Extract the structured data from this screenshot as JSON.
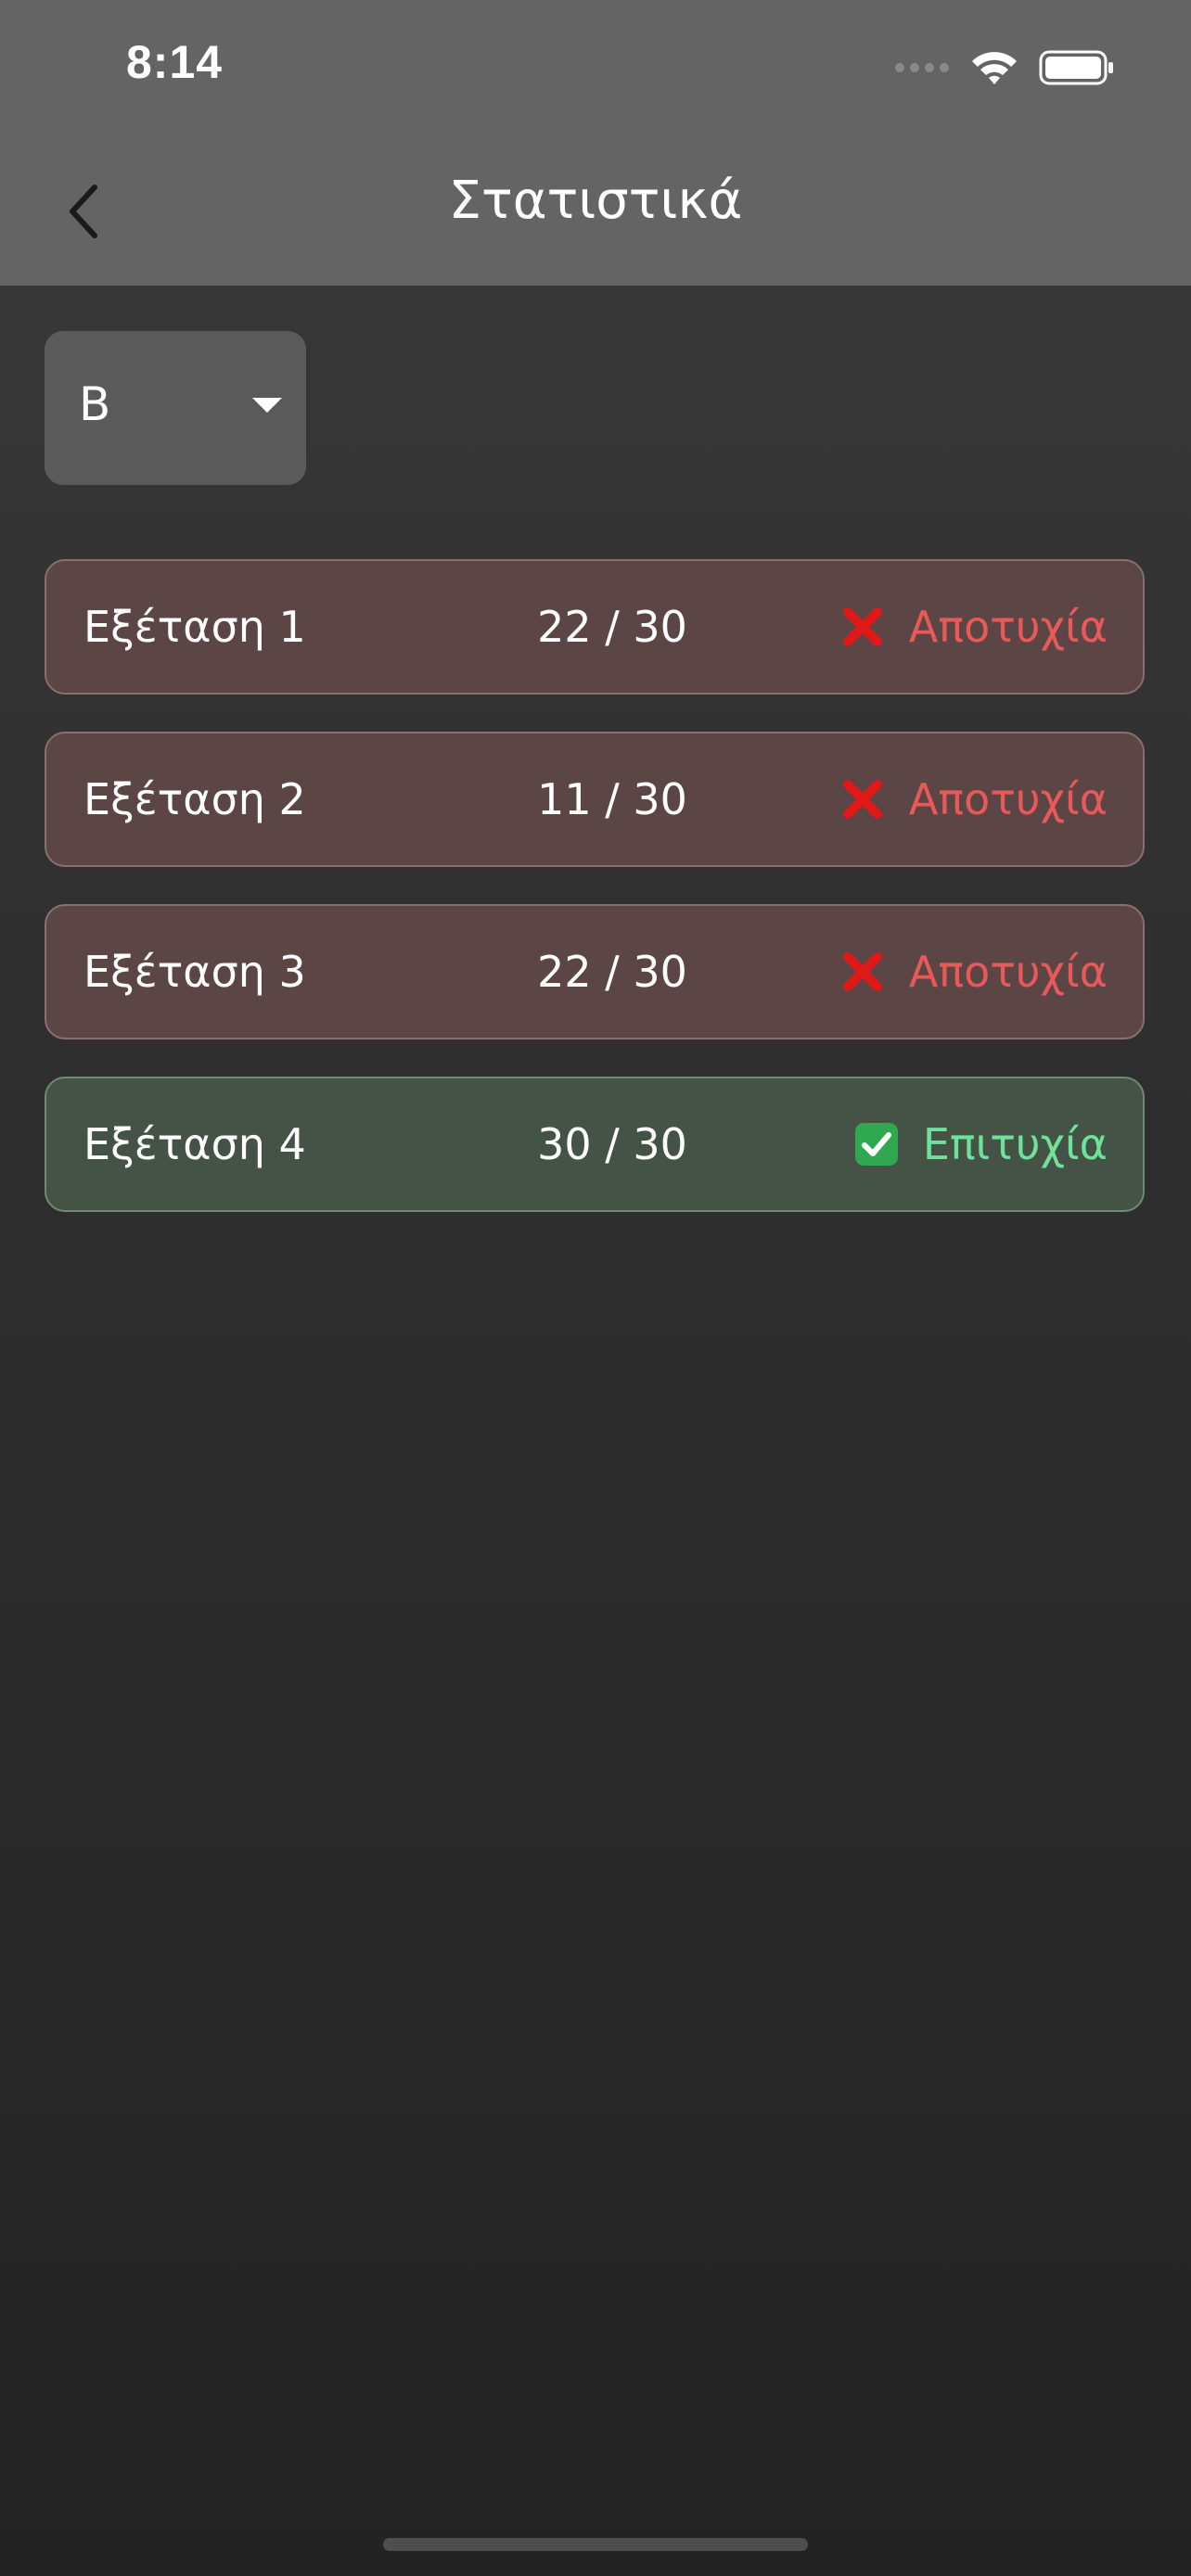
{
  "status_bar": {
    "time": "8:14",
    "icons": [
      "cellular-signal-icon",
      "wifi-icon",
      "battery-icon"
    ]
  },
  "nav": {
    "back_icon": "chevron-left-icon",
    "title": "Στατιστικά"
  },
  "dropdown": {
    "selected": "B",
    "icon": "caret-down-icon"
  },
  "exams": [
    {
      "name": "Εξέταση 1",
      "score": "22 / 30",
      "status": "Αποτυχία",
      "result": "fail",
      "icon": "cross-mark-icon"
    },
    {
      "name": "Εξέταση 2",
      "score": "11 / 30",
      "status": "Αποτυχία",
      "result": "fail",
      "icon": "cross-mark-icon"
    },
    {
      "name": "Εξέταση 3",
      "score": "22 / 30",
      "status": "Αποτυχία",
      "result": "fail",
      "icon": "cross-mark-icon"
    },
    {
      "name": "Εξέταση 4",
      "score": "30 / 30",
      "status": "Επιτυχία",
      "result": "pass",
      "icon": "check-mark-icon"
    }
  ],
  "colors": {
    "fail_text": "#e85a5a",
    "pass_text": "#6ee29a",
    "fail_row": "#5b4545",
    "pass_row": "#455246",
    "header": "#646464"
  }
}
